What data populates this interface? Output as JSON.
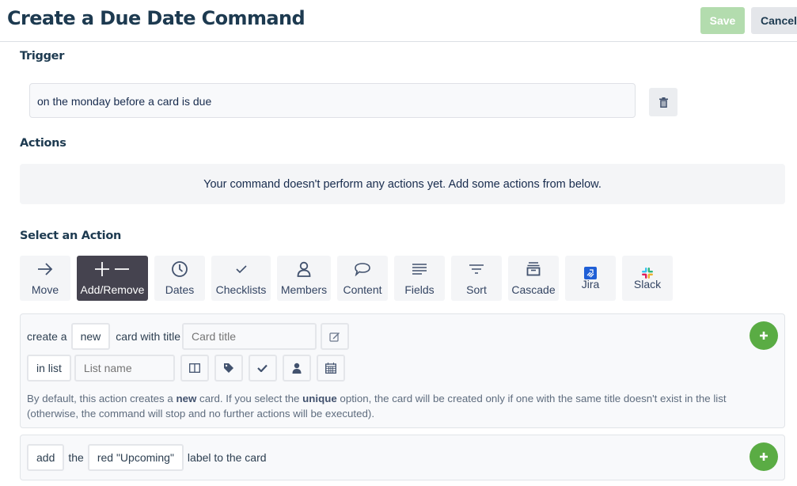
{
  "header": {
    "title": "Create a Due Date Command",
    "save_label": "Save",
    "cancel_label": "Cancel"
  },
  "trigger": {
    "heading": "Trigger",
    "value": "on the monday before a card is due",
    "delete_icon": "trash-icon"
  },
  "actions": {
    "heading": "Actions",
    "empty_message": "Your command doesn't perform any actions yet. Add some actions from below."
  },
  "select_action": {
    "heading": "Select an Action",
    "active_tab": "Add/Remove",
    "tabs": [
      {
        "label": "Move",
        "icon": "arrow-right-icon"
      },
      {
        "label": "Add/Remove",
        "icon": "plus-minus-icon"
      },
      {
        "label": "Dates",
        "icon": "clock-icon"
      },
      {
        "label": "Checklists",
        "icon": "checkmark-icon"
      },
      {
        "label": "Members",
        "icon": "person-icon"
      },
      {
        "label": "Content",
        "icon": "speech-bubble-icon"
      },
      {
        "label": "Fields",
        "icon": "lines-icon"
      },
      {
        "label": "Sort",
        "icon": "filter-icon"
      },
      {
        "label": "Cascade",
        "icon": "archive-box-icon"
      },
      {
        "label": "Jira",
        "icon": "jira-logo-icon"
      },
      {
        "label": "Slack",
        "icon": "slack-logo-icon"
      }
    ]
  },
  "create_card_action": {
    "prefix": "create a",
    "mode_value": "new",
    "mid_text": "card with title",
    "title_placeholder": "Card title",
    "list_prefix": "in list",
    "list_placeholder": "List name",
    "help_part1": "By default, this action creates a ",
    "help_bold1": "new",
    "help_part2": " card. If you select the ",
    "help_bold2": "unique",
    "help_part3": " option, the card will be created only if one with the same title doesn't exist in the list (otherwise, the command will stop and no further actions will be executed)."
  },
  "add_label_action": {
    "verb_value": "add",
    "the_text": "the",
    "label_value": "red \"Upcoming\"",
    "suffix": "label to the card"
  },
  "colors": {
    "accent_green": "#5aac44",
    "save_disabled": "#b3dcae",
    "active_tab": "#45434f"
  }
}
